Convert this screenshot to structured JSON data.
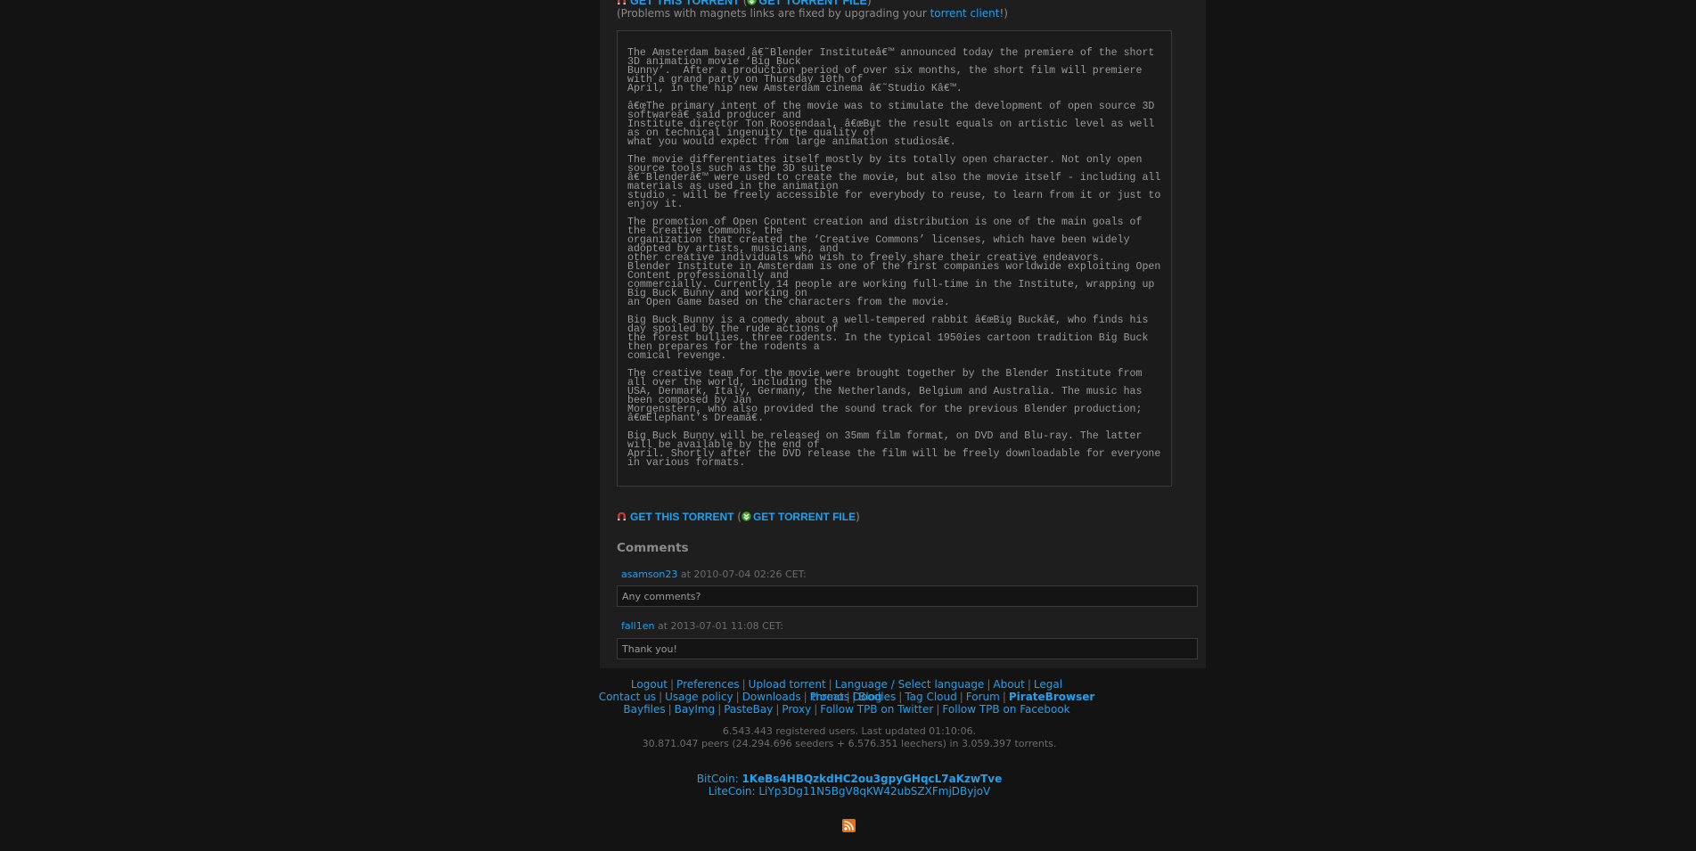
{
  "top": {
    "get_torrent": "GET THIS TORRENT",
    "paren_open": "(",
    "get_torrent_file": "GET TORRENT FILE",
    "paren_close": ")",
    "note_prefix": "(Problems with magnets links are fixed by upgrading your ",
    "note_link": "torrent client",
    "note_suffix": "!)"
  },
  "description": [
    "The Amsterdam based â€˜Blender Instituteâ€™ announced today the premiere of the short 3D animation movie ‘Big Buck\nBunny’.  After a production period of over six months, the short film will premiere with a grand party on Thursday 10th of\nApril, in the hip new Amsterdam cinema â€˜Studio Kâ€™.",
    "â€œThe primary intent of the movie was to stimulate the development of open source 3D softwareâ€ said producer and\nInstitute director Ton Roosendaal, â€œBut the result equals on artistic level as well as on technical ingenuity the quality of\nwhat you would expect from large animation studiosâ€.",
    "The movie differentiates itself mostly by its totally open character. Not only open source tools such as the 3D suite\nâ€˜Blenderâ€™ were used to create the movie, but also the movie itself - including all materials as used in the animation\nstudio - will be freely accessible for everybody to reuse, to learn from it or just to enjoy it.",
    "The promotion of Open Content creation and distribution is one of the main goals of the Creative Commons, the\norganization that created the ‘Creative Commons’ licenses, which have been widely adopted by artists, musicians, and\nother creative individuals who wish to freely share their creative endeavors.\nBlender Institute in Amsterdam is one of the first companies worldwide exploiting Open Content professionally and\ncommercially. Currently 14 people are working full-time in the Institute, wrapping up Big Buck Bunny and working on\nan Open Game based on the characters from the movie.",
    "Big Buck Bunny is a comedy about a well-tempered rabbit â€œBig Buckâ€, who finds his day spoiled by the rude actions of\nthe forest bullies, three rodents. In the typical 1950ies cartoon tradition Big Buck then prepares for the rodents a\ncomical revenge.",
    "The creative team for the movie were brought together by the Blender Institute from all over the world, including the\nUSA, Denmark, Italy, Germany, the Netherlands, Belgium and Australia. The music has been composed by Jan\nMorgenstern, who also provided the sound track for the previous Blender production; â€œElephant’s Dreamâ€.",
    "Big Buck Bunny will be released on 35mm film format, on DVD and Blu-ray. The latter will be available by the end of\nApril. Shortly after the DVD release the film will be freely downloadable for everyone in various formats."
  ],
  "bottom_links": {
    "get_torrent": "GET THIS TORRENT",
    "paren_open": "(",
    "get_torrent_file": "GET TORRENT FILE",
    "paren_close": ")"
  },
  "comments": {
    "title": "Comments",
    "items": [
      {
        "user": "asamson23",
        "meta": " at 2010-07-04 02:26 CET:",
        "text": "Any comments?"
      },
      {
        "user": "fall1en",
        "meta": " at 2013-07-01 11:08 CET:",
        "text": "Thank you!"
      }
    ]
  },
  "footer": {
    "row1": [
      "Logout",
      "Preferences",
      "Upload torrent",
      "Language / Select language",
      "About",
      "Legal threats",
      "Blog"
    ],
    "row2": [
      "Contact us",
      "Usage policy",
      "Downloads",
      "Promo",
      "Doodles",
      "Tag Cloud",
      "Forum",
      "PirateBrowser"
    ],
    "row3": [
      "Bayfiles",
      "BayImg",
      "PasteBay",
      "Proxy",
      "Follow TPB on Twitter",
      "Follow TPB on Facebook"
    ],
    "sep": "|"
  },
  "stats": {
    "line1": "6.543.443 registered users. Last updated 01:10:06.",
    "line2": "30.871.047 peers (24.294.696 seeders + 6.576.351 leechers) in 3.059.397 torrents."
  },
  "coins": {
    "btc_label": "BitCoin: ",
    "btc_addr": "1KeBs4HBQzkdHC2ou3gpyGHqcL7aKzwTve",
    "ltc_label": "LiteCoin: ",
    "ltc_addr": "LiYp3Dg11N5BgV8qKW42ubSZXFmjDByjoV"
  },
  "icons": {
    "rss": "rss-icon",
    "magnet": "magnet-icon",
    "download": "download-arrow-icon"
  },
  "colors": {
    "link": "#1fa1ef",
    "background": "#131313",
    "panel": "#1e1e1e",
    "rss": "#e86f12"
  }
}
